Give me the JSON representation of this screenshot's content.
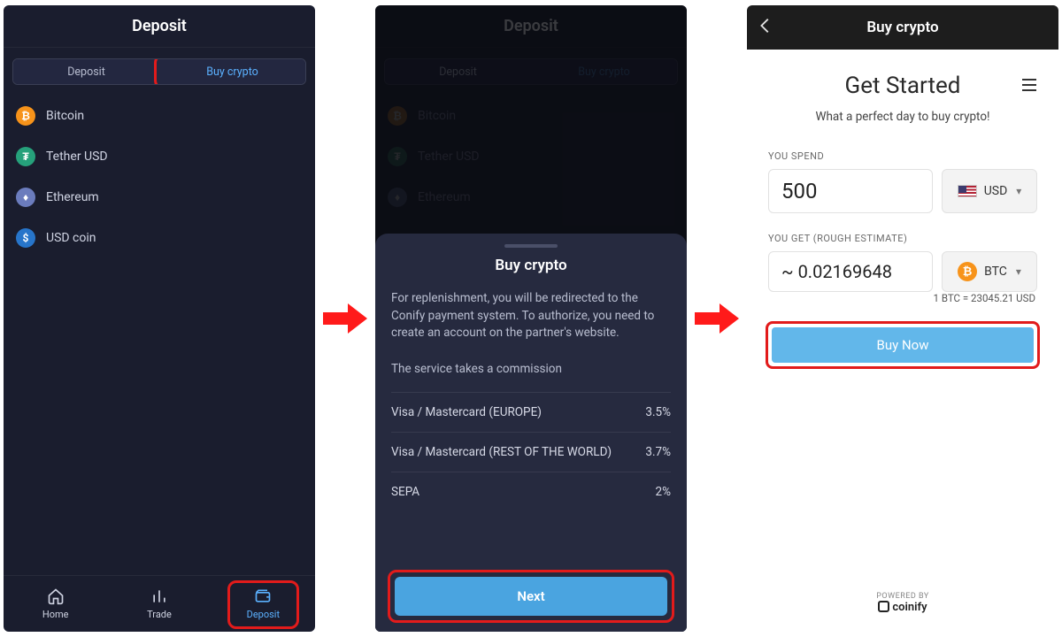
{
  "screen1": {
    "title": "Deposit",
    "tabs": {
      "deposit": "Deposit",
      "buy": "Buy crypto"
    },
    "coins": [
      {
        "name": "Bitcoin",
        "sym": "₿",
        "cls": "btc"
      },
      {
        "name": "Tether USD",
        "sym": "₮",
        "cls": "usdt"
      },
      {
        "name": "Ethereum",
        "sym": "♦",
        "cls": "eth"
      },
      {
        "name": "USD coin",
        "sym": "$",
        "cls": "usdc"
      }
    ],
    "nav": {
      "home": "Home",
      "trade": "Trade",
      "deposit": "Deposit"
    }
  },
  "screen2": {
    "sheet_title": "Buy crypto",
    "desc": "For replenishment, you will be redirected to the Conify payment system. To authorize, you need to create an account on the partner's website.",
    "commission_note": "The service takes a commission",
    "rows": [
      {
        "label": "Visa / Mastercard (EUROPE)",
        "fee": "3.5%"
      },
      {
        "label": "Visa / Mastercard (REST OF THE WORLD)",
        "fee": "3.7%"
      },
      {
        "label": "SEPA",
        "fee": "2%"
      }
    ],
    "next": "Next"
  },
  "screen3": {
    "header": "Buy crypto",
    "title": "Get Started",
    "subtitle": "What a perfect day to buy crypto!",
    "spend_label": "YOU SPEND",
    "spend_amount": "500",
    "spend_currency": "USD",
    "get_label": "YOU GET (ROUGH ESTIMATE)",
    "get_amount": "~ 0.02169648",
    "get_currency": "BTC",
    "rate": "1 BTC = 23045.21 USD",
    "buy": "Buy Now",
    "powered": "POWERED BY",
    "brand": "coinify"
  }
}
